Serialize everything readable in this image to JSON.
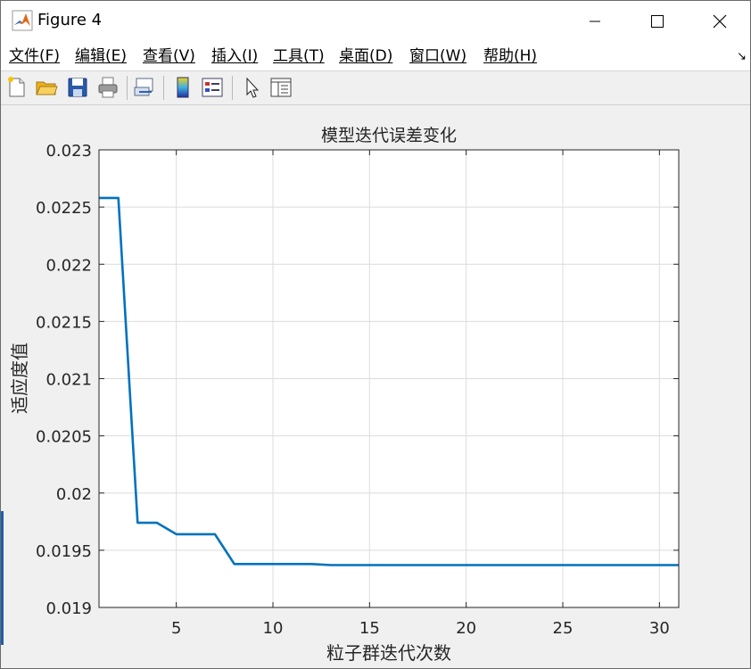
{
  "window": {
    "title": "Figure 4",
    "controls": {
      "minimize": "minimize",
      "maximize": "maximize",
      "close": "close"
    }
  },
  "menu": {
    "items": [
      "文件(F)",
      "编辑(E)",
      "查看(V)",
      "插入(I)",
      "工具(T)",
      "桌面(D)",
      "窗口(W)",
      "帮助(H)"
    ]
  },
  "toolbar": {
    "buttons": [
      "new-figure",
      "open-file",
      "save",
      "print",
      "link-plot",
      "colorbar",
      "legend",
      "select-pointer",
      "property-editor"
    ]
  },
  "chart_data": {
    "type": "line",
    "title": "模型迭代误差变化",
    "xlabel": "粒子群迭代次数",
    "ylabel": "适应度值",
    "xlim": [
      1,
      31
    ],
    "ylim": [
      0.019,
      0.023
    ],
    "xticks": [
      5,
      10,
      15,
      20,
      25,
      30
    ],
    "xtick_labels": [
      "5",
      "10",
      "15",
      "20",
      "25",
      "30"
    ],
    "yticks": [
      0.019,
      0.0195,
      0.02,
      0.0205,
      0.021,
      0.0215,
      0.022,
      0.0225,
      0.023
    ],
    "ytick_labels": [
      "0.019",
      "0.0195",
      "0.02",
      "0.0205",
      "0.021",
      "0.0215",
      "0.022",
      "0.0225",
      "0.023"
    ],
    "grid": true,
    "series": [
      {
        "color": "#0072BD",
        "x": [
          1,
          2,
          3,
          4,
          5,
          6,
          7,
          8,
          9,
          10,
          11,
          12,
          13,
          14,
          15,
          16,
          17,
          18,
          19,
          20,
          21,
          22,
          23,
          24,
          25,
          26,
          27,
          28,
          29,
          30,
          31
        ],
        "y": [
          0.02258,
          0.02258,
          0.01974,
          0.01974,
          0.01964,
          0.01964,
          0.01964,
          0.01938,
          0.01938,
          0.01938,
          0.01938,
          0.01938,
          0.01937,
          0.01937,
          0.01937,
          0.01937,
          0.01937,
          0.01937,
          0.01937,
          0.01937,
          0.01937,
          0.01937,
          0.01937,
          0.01937,
          0.01937,
          0.01937,
          0.01937,
          0.01937,
          0.01937,
          0.01937,
          0.01937
        ]
      }
    ]
  }
}
